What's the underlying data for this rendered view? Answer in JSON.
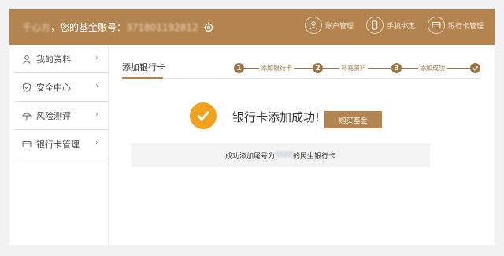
{
  "header": {
    "account_name": "千心方",
    "account_prefix": "，您的基金账号：",
    "account_number": "371801192812",
    "nav": [
      {
        "label": "账户管理",
        "icon": "user-icon"
      },
      {
        "label": "手机绑定",
        "icon": "phone-icon"
      },
      {
        "label": "银行卡管理",
        "icon": "card-icon"
      }
    ]
  },
  "sidebar": {
    "items": [
      {
        "label": "我的资料",
        "icon": "user-icon"
      },
      {
        "label": "安全中心",
        "icon": "shield-icon"
      },
      {
        "label": "风险测评",
        "icon": "umbrella-icon"
      },
      {
        "label": "银行卡管理",
        "icon": "card-icon"
      }
    ]
  },
  "main": {
    "tab_label": "添加银行卡",
    "steps": [
      {
        "num": "1",
        "label": "添加银行卡"
      },
      {
        "num": "2",
        "label": "补充资料"
      },
      {
        "num": "3",
        "label": "添加成功"
      }
    ],
    "success_title": "银行卡添加成功!",
    "buy_button": "购买基金",
    "notice_prefix": "成功添加尾号为",
    "notice_tail": "8888",
    "notice_suffix": "的民生银行卡"
  },
  "colors": {
    "brand": "#b3844f",
    "step": "#9d7444",
    "success": "#f0a21e"
  }
}
